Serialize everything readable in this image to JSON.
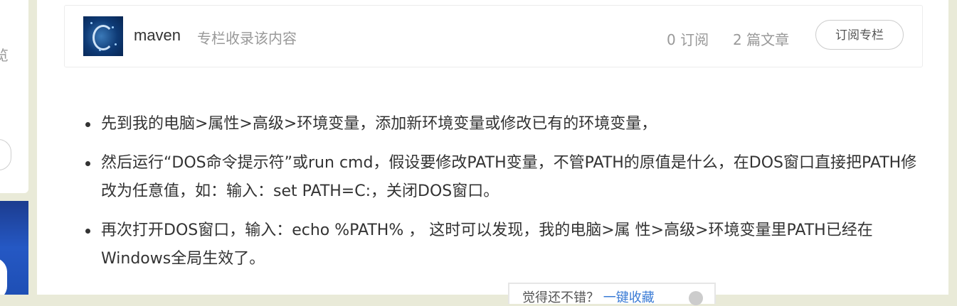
{
  "sidebar": {
    "partial_char": "览"
  },
  "column": {
    "name": "maven",
    "description": "专栏收录该内容",
    "subscribers": "0 订阅",
    "articles": "2 篇文章",
    "subscribe_button": "订阅专栏"
  },
  "article": {
    "items": [
      "先到我的电脑>属性>高级>环境变量，添加新环境变量或修改已有的环境变量，",
      "然后运行“DOS命令提示符”或run cmd，假设要修改PATH变量，不管PATH的原值是什么，在DOS窗口直接把PATH修改为任意值，如：输入：set PATH=C:，关闭DOS窗口。",
      "再次打开DOS窗口，输入：echo %PATH% ， 这时可以发现，我的电脑>属 性>高级>环境变量里PATH已经在Windows全局生效了。"
    ]
  },
  "footer": {
    "question": "觉得还不错？",
    "link": "一键收藏"
  }
}
